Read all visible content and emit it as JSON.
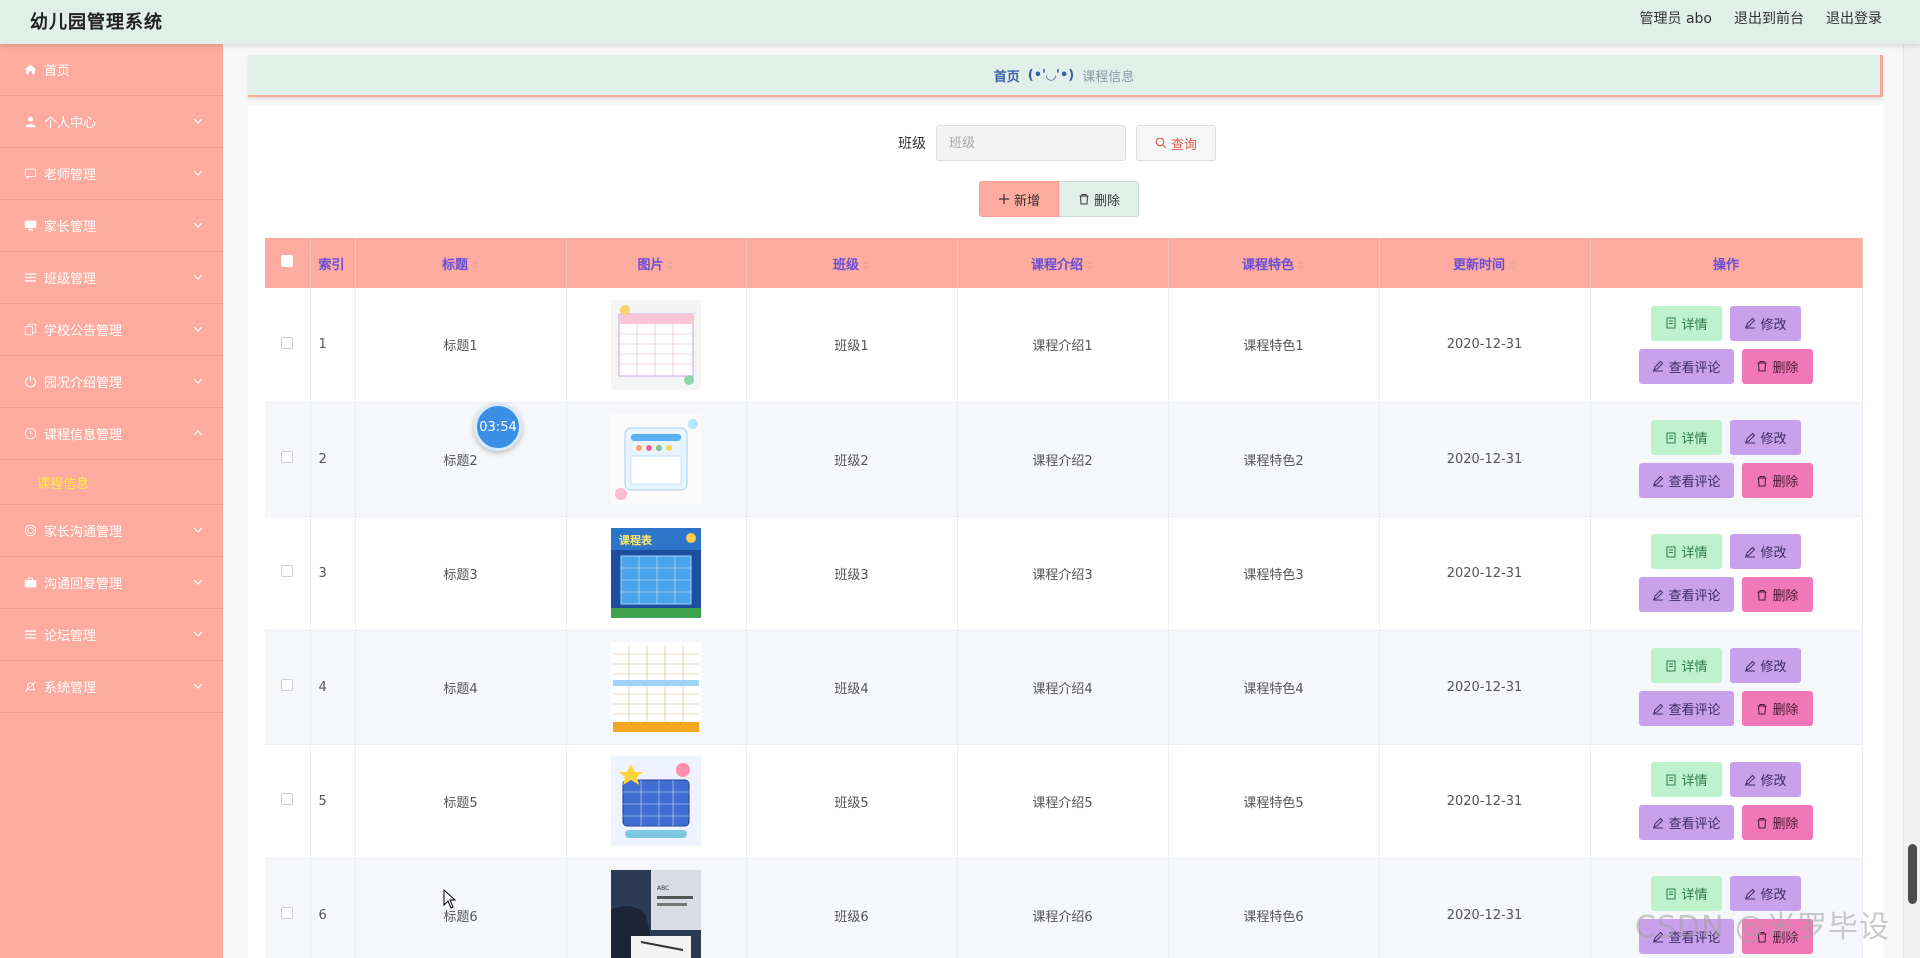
{
  "app_title": "幼儿园管理系统",
  "top_links": [
    "管理员 abo",
    "退出到前台",
    "退出登录"
  ],
  "sidebar": {
    "items": [
      {
        "label": "首页",
        "icon": "home-icon",
        "has_children": false,
        "expanded": false
      },
      {
        "label": "个人中心",
        "icon": "user-icon",
        "has_children": true,
        "expanded": false
      },
      {
        "label": "老师管理",
        "icon": "chat-icon",
        "has_children": true,
        "expanded": false
      },
      {
        "label": "家长管理",
        "icon": "monitor-icon",
        "has_children": true,
        "expanded": false
      },
      {
        "label": "班级管理",
        "icon": "list-icon",
        "has_children": true,
        "expanded": false
      },
      {
        "label": "学校公告管理",
        "icon": "copy-icon",
        "has_children": true,
        "expanded": false
      },
      {
        "label": "园况介绍管理",
        "icon": "power-icon",
        "has_children": true,
        "expanded": false
      },
      {
        "label": "课程信息管理",
        "icon": "clock-icon",
        "has_children": true,
        "expanded": true,
        "children": [
          "课程信息"
        ]
      },
      {
        "label": "家长沟通管理",
        "icon": "target-icon",
        "has_children": true,
        "expanded": false
      },
      {
        "label": "沟通回复管理",
        "icon": "briefcase-icon",
        "has_children": true,
        "expanded": false
      },
      {
        "label": "论坛管理",
        "icon": "list-icon",
        "has_children": true,
        "expanded": false
      },
      {
        "label": "系统管理",
        "icon": "bell-off-icon",
        "has_children": true,
        "expanded": false
      }
    ]
  },
  "breadcrumb": {
    "home": "首页",
    "separator": "(•'◡'•)",
    "current": "课程信息"
  },
  "search": {
    "label": "班级",
    "placeholder": "班级",
    "button": "查询"
  },
  "actions": {
    "add": "新增",
    "delete": "删除"
  },
  "table": {
    "columns": [
      "索引",
      "标题",
      "图片",
      "班级",
      "课程介绍",
      "课程特色",
      "更新时间",
      "操作"
    ],
    "rows": [
      {
        "index": "1",
        "title": "标题1",
        "image": "schedule-chart-image",
        "class": "班级1",
        "intro": "课程介绍1",
        "feature": "课程特色1",
        "updated": "2020-12-31"
      },
      {
        "index": "2",
        "title": "标题2",
        "image": "cartoon-card-image",
        "class": "班级2",
        "intro": "课程介绍2",
        "feature": "课程特色2",
        "updated": "2020-12-31"
      },
      {
        "index": "3",
        "title": "标题3",
        "image": "blue-timetable-image",
        "class": "班级3",
        "intro": "课程介绍3",
        "feature": "课程特色3",
        "updated": "2020-12-31"
      },
      {
        "index": "4",
        "title": "标题4",
        "image": "spreadsheet-image",
        "class": "班级4",
        "intro": "课程介绍4",
        "feature": "课程特色4",
        "updated": "2020-12-31"
      },
      {
        "index": "5",
        "title": "标题5",
        "image": "cartoon-timetable-image",
        "class": "班级5",
        "intro": "课程介绍5",
        "feature": "课程特色5",
        "updated": "2020-12-31"
      },
      {
        "index": "6",
        "title": "标题6",
        "image": "study-photo-image",
        "class": "班级6",
        "intro": "课程介绍6",
        "feature": "课程特色6",
        "updated": "2020-12-31"
      }
    ],
    "row_actions": {
      "detail": "详情",
      "edit": "修改",
      "comments": "查看评论",
      "delete": "删除"
    }
  },
  "overlay": {
    "timer": "03:54",
    "watermark": "CSDN @米罗毕设"
  },
  "colors": {
    "topbar": "#e0efe8",
    "sidebar": "#fdab9e",
    "header": "#fdab9e",
    "active_submenu": "#ffee3a",
    "detail_btn": "#bdf2cd",
    "edit_btn": "#c9a0ec",
    "delete_btn": "#f078b8"
  }
}
